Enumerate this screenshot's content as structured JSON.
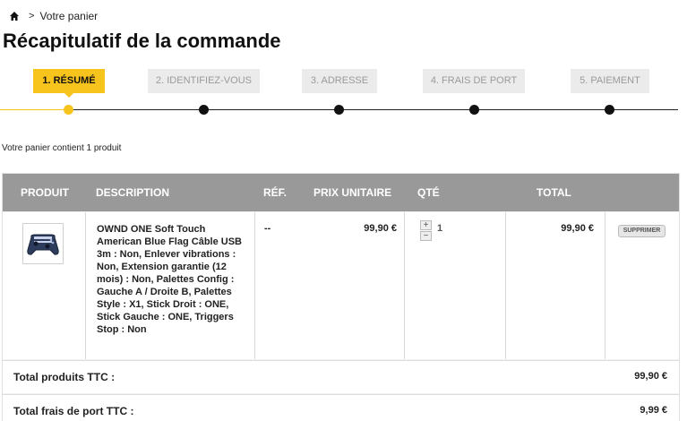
{
  "breadcrumb": {
    "home_icon": "home-icon",
    "separator": ">",
    "current": "Votre panier"
  },
  "page_title": "Récapitulatif de la commande",
  "steps": {
    "resume": "1. RÉSUMÉ",
    "identify": "2. IDENTIFIEZ-VOUS",
    "address": "3. ADRESSE",
    "shipping": "4. FRAIS DE PORT",
    "payment": "5. PAIEMENT",
    "active_color": "#f7c31d",
    "inactive_bg": "#ebebeb"
  },
  "summary": "Votre panier contient 1 produit",
  "table": {
    "headers": {
      "product": "PRODUIT",
      "description": "DESCRIPTION",
      "ref": "RÉF.",
      "unit_price": "PRIX UNITAIRE",
      "qty": "QTÉ",
      "total": "TOTAL"
    },
    "item": {
      "description": "OWND ONE Soft Touch American Blue Flag Câble USB 3m : Non, Enlever vibrations : Non, Extension garantie (12 mois) : Non, Palettes Config : Gauche A / Droite B, Palettes Style : X1, Stick Droit : ONE, Stick Gauche : ONE, Triggers Stop : Non",
      "ref": "--",
      "unit_price": "99,90 €",
      "qty_plus": "+",
      "qty_minus": "−",
      "qty": "1",
      "total": "99,90 €",
      "delete_label": "SUPPRIMER"
    },
    "totals": {
      "products_label": "Total produits TTC :",
      "products_value": "99,90 €",
      "shipping_label": "Total frais de port TTC :",
      "shipping_value": "9,99 €"
    }
  },
  "colors": {
    "header_bg": "#999999",
    "accent": "#f7c31d"
  }
}
